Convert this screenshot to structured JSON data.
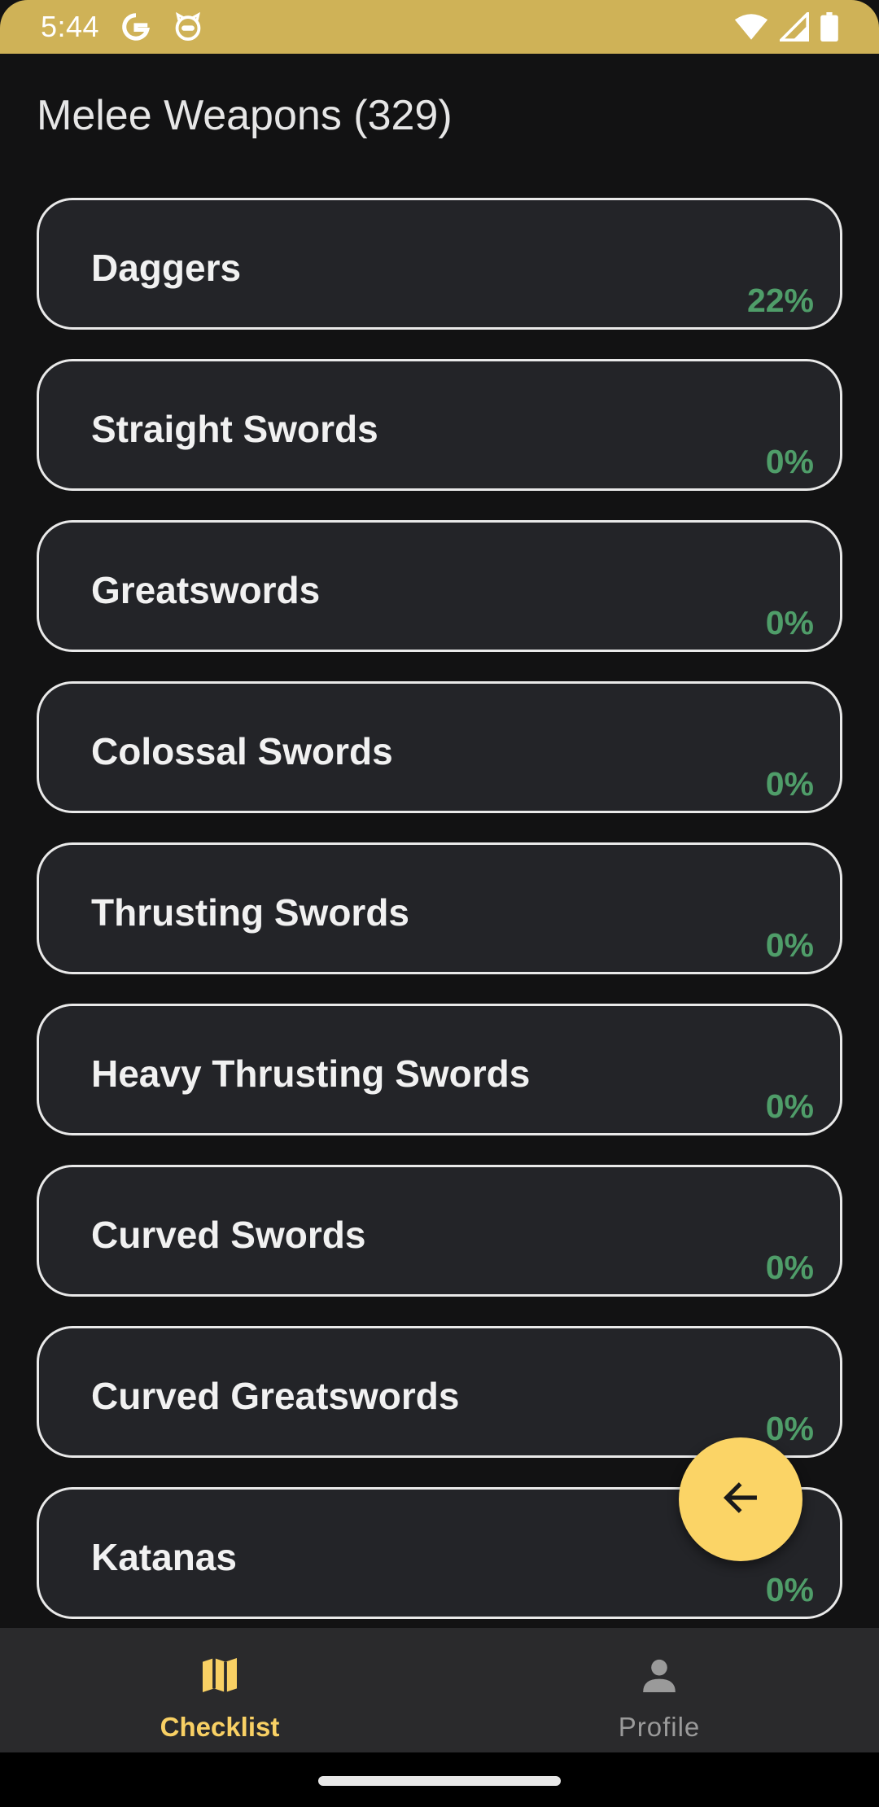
{
  "status_bar": {
    "time": "5:44",
    "icons_left": [
      "google-g-icon",
      "robot-cat-icon"
    ],
    "icons_right": [
      "wifi-icon",
      "signal-icon",
      "battery-icon"
    ]
  },
  "page": {
    "title": "Melee Weapons (329)"
  },
  "categories": [
    {
      "name": "Daggers",
      "percent": "22%"
    },
    {
      "name": "Straight Swords",
      "percent": "0%"
    },
    {
      "name": "Greatswords",
      "percent": "0%"
    },
    {
      "name": "Colossal Swords",
      "percent": "0%"
    },
    {
      "name": "Thrusting Swords",
      "percent": "0%"
    },
    {
      "name": "Heavy Thrusting Swords",
      "percent": "0%"
    },
    {
      "name": "Curved Swords",
      "percent": "0%"
    },
    {
      "name": "Curved Greatswords",
      "percent": "0%"
    },
    {
      "name": "Katanas",
      "percent": "0%"
    }
  ],
  "fab": {
    "icon": "arrow-back-icon"
  },
  "bottom_nav": {
    "items": [
      {
        "label": "Checklist",
        "icon": "map-icon",
        "active": true
      },
      {
        "label": "Profile",
        "icon": "person-icon",
        "active": false
      }
    ]
  },
  "colors": {
    "status_bar": "#cfb257",
    "background": "#121213",
    "card": "#232428",
    "percent_green": "#4f9d69",
    "accent_yellow": "#fbd466"
  }
}
